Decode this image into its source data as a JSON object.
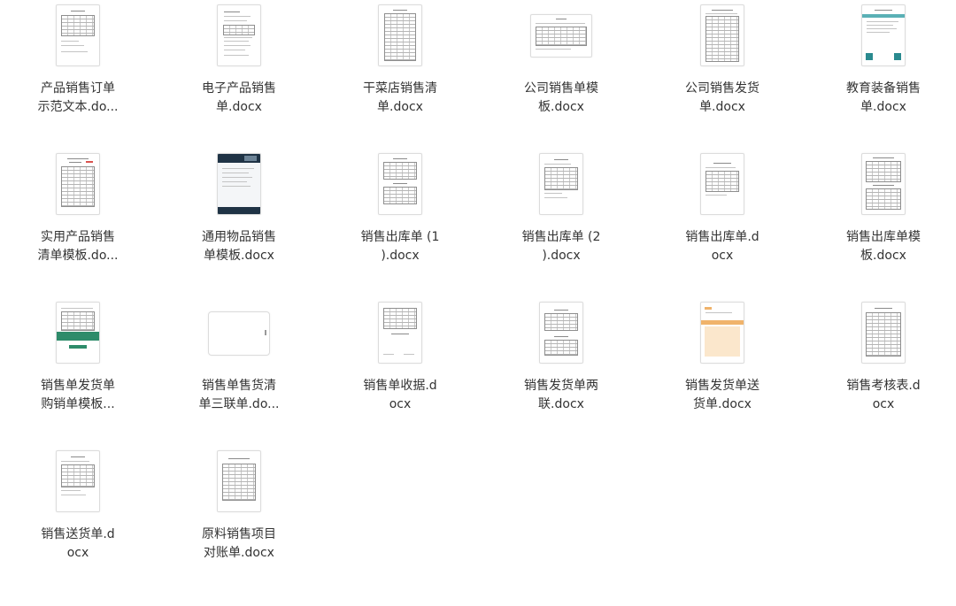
{
  "files": [
    {
      "line1": "产品销售订单",
      "line2": "示范文本.do..."
    },
    {
      "line1": "电子产品销售",
      "line2": "单.docx"
    },
    {
      "line1": "干菜店销售清",
      "line2": "单.docx"
    },
    {
      "line1": "公司销售单模",
      "line2": "板.docx"
    },
    {
      "line1": "公司销售发货",
      "line2": "单.docx"
    },
    {
      "line1": "教育装备销售",
      "line2": "单.docx"
    },
    {
      "line1": "实用产品销售",
      "line2": "清单模板.do..."
    },
    {
      "line1": "通用物品销售",
      "line2": "单模板.docx"
    },
    {
      "line1": "销售出库单 (1",
      "line2": ").docx"
    },
    {
      "line1": "销售出库单 (2",
      "line2": ").docx"
    },
    {
      "line1": "销售出库单.d",
      "line2": "ocx"
    },
    {
      "line1": "销售出库单模",
      "line2": "板.docx"
    },
    {
      "line1": "销售单发货单",
      "line2": "购销单模板..."
    },
    {
      "line1": "销售单售货清",
      "line2": "单三联单.do..."
    },
    {
      "line1": "销售单收据.d",
      "line2": "ocx"
    },
    {
      "line1": "销售发货单两",
      "line2": "联.docx"
    },
    {
      "line1": "销售发货单送",
      "line2": "货单.docx"
    },
    {
      "line1": "销售考核表.d",
      "line2": "ocx"
    },
    {
      "line1": "销售送货单.d",
      "line2": "ocx"
    },
    {
      "line1": "原料销售项目",
      "line2": "对账单.docx"
    }
  ],
  "icons": {
    "document_thumbnail": "docx-thumbnail-icon"
  },
  "colors": {
    "teal_accent": "#2a8a8f",
    "green_band": "#2e8b6a",
    "navy_header": "#1f3345",
    "orange_band": "#f0b36b",
    "label_text": "#333333"
  }
}
